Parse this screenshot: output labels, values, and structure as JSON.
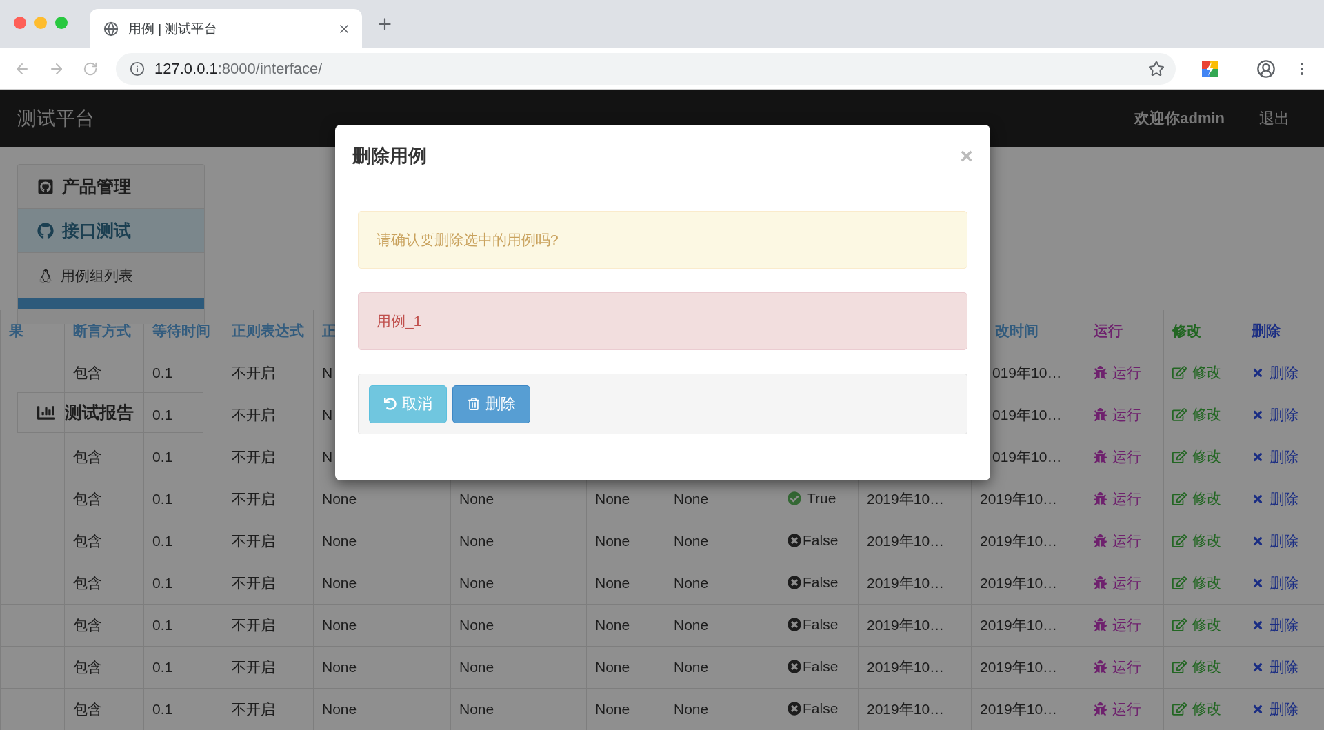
{
  "browser": {
    "tab_title": "用例 | 测试平台",
    "url_host": "127.0.0.1",
    "url_rest": ":8000/interface/"
  },
  "navbar": {
    "brand": "测试平台",
    "user": "欢迎你admin",
    "logout": "退出"
  },
  "sidebar": {
    "items": [
      {
        "label": "产品管理",
        "kind": "group",
        "selected": false
      },
      {
        "label": "接口测试",
        "kind": "group",
        "selected": true
      },
      {
        "label": "用例组列表",
        "kind": "sub",
        "selected": false
      }
    ],
    "report": {
      "label": "测试报告"
    }
  },
  "table": {
    "columns": [
      {
        "label": "果",
        "kind": "text"
      },
      {
        "label": "断言方式",
        "kind": "text"
      },
      {
        "label": "等待时间",
        "kind": "text"
      },
      {
        "label": "正则表达式",
        "kind": "text"
      },
      {
        "label": "正",
        "kind": "text"
      },
      null,
      null,
      null,
      null,
      null,
      {
        "label": "改时间",
        "kind": "text",
        "partial": true
      },
      {
        "label": "运行",
        "kind": "run"
      },
      {
        "label": "修改",
        "kind": "edit"
      },
      {
        "label": "删除",
        "kind": "delete"
      }
    ],
    "rows": [
      {
        "cells": [
          null,
          "包含",
          "0.1",
          "不开启",
          "N",
          null,
          null,
          null,
          null,
          null,
          {
            "kind": "partial",
            "text": "019年10…"
          },
          {
            "kind": "run",
            "text": "运行"
          },
          {
            "kind": "edit",
            "text": "修改"
          },
          {
            "kind": "delete",
            "text": "删除"
          }
        ]
      },
      {
        "cells": [
          null,
          null,
          "0.1",
          "不开启",
          "N",
          null,
          null,
          null,
          null,
          null,
          {
            "kind": "partial",
            "text": "019年10…"
          },
          {
            "kind": "run",
            "text": "运行"
          },
          {
            "kind": "edit",
            "text": "修改"
          },
          {
            "kind": "delete",
            "text": "删除"
          }
        ]
      },
      {
        "cells": [
          null,
          "包含",
          "0.1",
          "不开启",
          "N",
          null,
          null,
          null,
          null,
          null,
          {
            "kind": "partial",
            "text": "019年10…"
          },
          {
            "kind": "run",
            "text": "运行"
          },
          {
            "kind": "edit",
            "text": "修改"
          },
          {
            "kind": "delete",
            "text": "删除"
          }
        ]
      },
      {
        "cells": [
          null,
          "包含",
          "0.1",
          "不开启",
          "None",
          "None",
          "None",
          "None",
          {
            "kind": "status",
            "ok": true,
            "text": "True"
          },
          "2019年10…",
          "2019年10…",
          {
            "kind": "run",
            "text": "运行"
          },
          {
            "kind": "edit",
            "text": "修改"
          },
          {
            "kind": "delete",
            "text": "删除"
          }
        ]
      },
      {
        "cells": [
          null,
          "包含",
          "0.1",
          "不开启",
          "None",
          "None",
          "None",
          "None",
          {
            "kind": "status",
            "ok": false,
            "text": "False"
          },
          "2019年10…",
          "2019年10…",
          {
            "kind": "run",
            "text": "运行"
          },
          {
            "kind": "edit",
            "text": "修改"
          },
          {
            "kind": "delete",
            "text": "删除"
          }
        ]
      },
      {
        "cells": [
          null,
          "包含",
          "0.1",
          "不开启",
          "None",
          "None",
          "None",
          "None",
          {
            "kind": "status",
            "ok": false,
            "text": "False"
          },
          "2019年10…",
          "2019年10…",
          {
            "kind": "run",
            "text": "运行"
          },
          {
            "kind": "edit",
            "text": "修改"
          },
          {
            "kind": "delete",
            "text": "删除"
          }
        ]
      },
      {
        "cells": [
          null,
          "包含",
          "0.1",
          "不开启",
          "None",
          "None",
          "None",
          "None",
          {
            "kind": "status",
            "ok": false,
            "text": "False"
          },
          "2019年10…",
          "2019年10…",
          {
            "kind": "run",
            "text": "运行"
          },
          {
            "kind": "edit",
            "text": "修改"
          },
          {
            "kind": "delete",
            "text": "删除"
          }
        ]
      },
      {
        "cells": [
          null,
          "包含",
          "0.1",
          "不开启",
          "None",
          "None",
          "None",
          "None",
          {
            "kind": "status",
            "ok": false,
            "text": "False"
          },
          "2019年10…",
          "2019年10…",
          {
            "kind": "run",
            "text": "运行"
          },
          {
            "kind": "edit",
            "text": "修改"
          },
          {
            "kind": "delete",
            "text": "删除"
          }
        ]
      },
      {
        "cells": [
          null,
          "包含",
          "0.1",
          "不开启",
          "None",
          "None",
          "None",
          "None",
          {
            "kind": "status",
            "ok": false,
            "text": "False"
          },
          "2019年10…",
          "2019年10…",
          {
            "kind": "run",
            "text": "运行"
          },
          {
            "kind": "edit",
            "text": "修改"
          },
          {
            "kind": "delete",
            "text": "删除"
          }
        ]
      }
    ]
  },
  "modal": {
    "title": "删除用例",
    "close": "×",
    "warning": "请确认要删除选中的用例吗?",
    "item": "用例_1",
    "cancel": "取消",
    "confirm": "删除"
  }
}
